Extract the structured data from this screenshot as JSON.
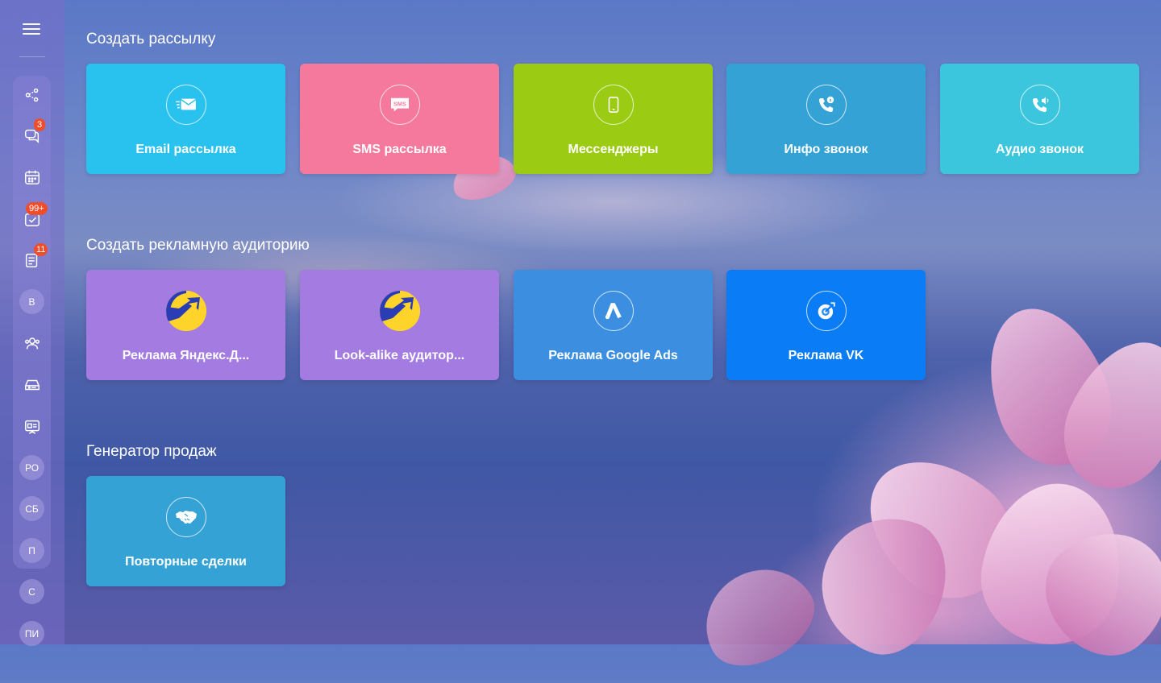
{
  "sidebar": {
    "badges": {
      "chats": "3",
      "tasks": "99+",
      "docs": "11"
    },
    "avatars": [
      "В",
      "РО",
      "СБ",
      "П",
      "С",
      "ПИ"
    ]
  },
  "sections": {
    "mailing": {
      "title": "Создать рассылку",
      "cards": [
        {
          "label": "Email рассылка",
          "icon": "email-icon",
          "color": "#29c2ee"
        },
        {
          "label": "SMS рассылка",
          "icon": "sms-icon",
          "color": "#f4799d"
        },
        {
          "label": "Мессенджеры",
          "icon": "phone-icon",
          "color": "#9ccb14"
        },
        {
          "label": "Инфо звонок",
          "icon": "info-call-icon",
          "color": "#35a2d5"
        },
        {
          "label": "Аудио звонок",
          "icon": "audio-call-icon",
          "color": "#3bc6dd"
        }
      ]
    },
    "audience": {
      "title": "Создать рекламную аудиторию",
      "cards": [
        {
          "label": "Реклама Яндекс.Д...",
          "icon": "yandex-direct-icon",
          "color": "#a37be1"
        },
        {
          "label": "Look-alike аудитор...",
          "icon": "yandex-direct-icon",
          "color": "#a37be1"
        },
        {
          "label": "Реклама Google Ads",
          "icon": "google-ads-icon",
          "color": "#3c8fe0"
        },
        {
          "label": "Реклама VK",
          "icon": "vk-ads-icon",
          "color": "#0a7cf6"
        }
      ]
    },
    "sales": {
      "title": "Генератор продаж",
      "cards": [
        {
          "label": "Повторные сделки",
          "icon": "handshake-icon",
          "color": "#35a2d5"
        }
      ]
    }
  }
}
